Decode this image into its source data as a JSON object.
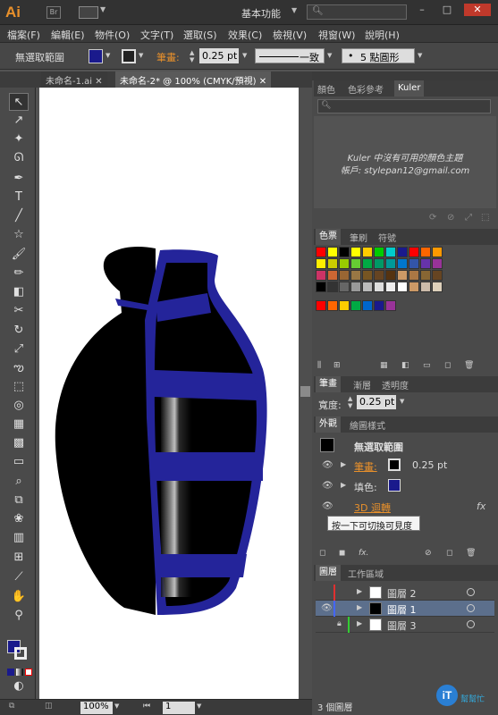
{
  "app": {
    "logo": "Ai",
    "bridge_label": "Br",
    "workspace": "基本功能",
    "search_placeholder": ""
  },
  "menu": [
    "檔案(F)",
    "編輯(E)",
    "物件(O)",
    "文字(T)",
    "選取(S)",
    "效果(C)",
    "檢視(V)",
    "視窗(W)",
    "說明(H)"
  ],
  "control": {
    "selection": "無選取範圍",
    "stroke_label": "筆畫:",
    "stroke_value": "0.25 pt",
    "profile": "一致",
    "brush": "5 點圓形"
  },
  "tabs": [
    "未命名-1.ai",
    "未命名-2* @ 100% (CMYK/預視)"
  ],
  "color_panel": {
    "tabs": [
      "顏色",
      "色彩參考",
      "Kuler"
    ],
    "kuler_msg_1": "Kuler 中沒有可用的顏色主題",
    "kuler_msg_2": "帳戶: stylepan12@gmail.com"
  },
  "swatch_panel": {
    "tabs": [
      "色票",
      "筆刷",
      "符號"
    ],
    "row1": [
      "#ff0000",
      "#ffff00",
      "#000000",
      "#ffff00",
      "#ffcc00",
      "#00cc00",
      "#00cccc",
      "#1a1a8c",
      "#ff0000",
      "#ff6600",
      "#ff9900"
    ],
    "row2": [
      "#ffee00",
      "#cccc00",
      "#99cc00",
      "#66cc33",
      "#00aa44",
      "#009966",
      "#009999",
      "#0077cc",
      "#3355aa",
      "#6633aa",
      "#993399"
    ],
    "row3": [
      "#cc3366",
      "#cc6633",
      "#996633",
      "#997744",
      "#775522",
      "#664422",
      "#553311",
      "#cc9966",
      "#aa7744",
      "#886633",
      "#664422"
    ],
    "row4": [
      "#000000",
      "#333333",
      "#666666",
      "#999999",
      "#bbbbbb",
      "#dddddd",
      "#eeeeee",
      "#ffffff",
      "#cc9966",
      "#ccbbaa",
      "#ddd0bb"
    ],
    "row5": [
      "#ff0000",
      "#ff6600",
      "#ffcc00",
      "#00aa44",
      "#0066cc",
      "#1a1a8c",
      "#993399"
    ]
  },
  "stroke_panel": {
    "tabs": [
      "筆畫",
      "漸層",
      "透明度"
    ],
    "weight_label": "寬度:",
    "weight_value": "0.25 pt"
  },
  "appearance_panel": {
    "tabs": [
      "外觀",
      "繪圖樣式"
    ],
    "title": "無選取範圍",
    "stroke_label": "筆畫:",
    "stroke_value": "0.25 pt",
    "fill_label": "填色:",
    "effect_label": "3D 迴轉",
    "fx": "fx",
    "tooltip": "按一下可切換可見度"
  },
  "layers_panel": {
    "tabs": [
      "圖層",
      "工作區域"
    ],
    "layers": [
      {
        "name": "圖層 2",
        "color": "#e03030"
      },
      {
        "name": "圖層 1",
        "color": "#4466ff"
      },
      {
        "name": "圖層 3",
        "color": "#33cc33"
      }
    ],
    "count": "3 個圖層"
  },
  "status": {
    "zoom": "100%",
    "artboard": "1"
  },
  "brand": {
    "text": "iT",
    "subtext": "幫幫忙"
  }
}
